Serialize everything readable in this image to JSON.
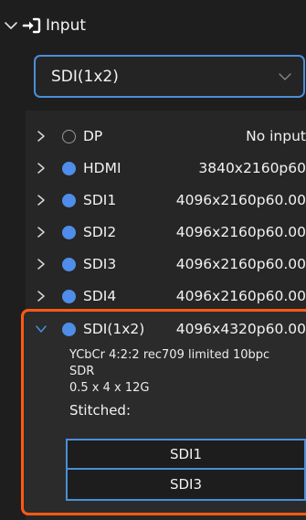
{
  "header": {
    "title": "Input",
    "chevron_icon": "chevron-down-icon",
    "section_icon": "input-arrow-icon"
  },
  "dropdown": {
    "selected": "SDI(1x2)"
  },
  "inputs": [
    {
      "name": "DP",
      "status": "No input",
      "active": false
    },
    {
      "name": "HDMI",
      "status": "3840x2160p60",
      "active": true
    },
    {
      "name": "SDI1",
      "status": "4096x2160p60.00",
      "active": true
    },
    {
      "name": "SDI2",
      "status": "4096x2160p60.00",
      "active": true
    },
    {
      "name": "SDI3",
      "status": "4096x2160p60.00",
      "active": true
    },
    {
      "name": "SDI4",
      "status": "4096x2160p60.00",
      "active": true
    }
  ],
  "expanded": {
    "name": "SDI(1x2)",
    "status": "4096x4320p60.00",
    "format": "YCbCr 4:2:2 rec709 limited 10bpc",
    "dynamic_range": "SDR",
    "link": "0.5 x 4 x 12G",
    "stitched_label": "Stitched:",
    "stitched": [
      "SDI1",
      "SDI3"
    ]
  },
  "colors": {
    "accent_blue": "#4a8fd8",
    "highlight_orange": "#ff5a14",
    "background": "#1e1e1e"
  }
}
